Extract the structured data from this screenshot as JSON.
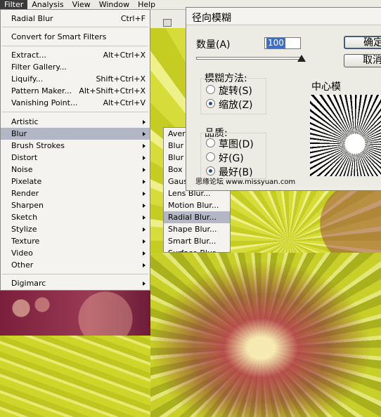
{
  "menubar": {
    "items": [
      "Filter",
      "Analysis",
      "View",
      "Window",
      "Help"
    ]
  },
  "filter_menu": {
    "items": [
      {
        "label": "Radial Blur",
        "shortcut": "Ctrl+F"
      },
      {
        "label": "Convert for Smart Filters",
        "shortcut": ""
      },
      {
        "label": "Extract...",
        "shortcut": "Alt+Ctrl+X"
      },
      {
        "label": "Filter Gallery...",
        "shortcut": ""
      },
      {
        "label": "Liquify...",
        "shortcut": "Shift+Ctrl+X"
      },
      {
        "label": "Pattern Maker...",
        "shortcut": "Alt+Shift+Ctrl+X"
      },
      {
        "label": "Vanishing Point...",
        "shortcut": "Alt+Ctrl+V"
      },
      {
        "label": "Artistic",
        "shortcut": ""
      },
      {
        "label": "Blur",
        "shortcut": ""
      },
      {
        "label": "Brush Strokes",
        "shortcut": ""
      },
      {
        "label": "Distort",
        "shortcut": ""
      },
      {
        "label": "Noise",
        "shortcut": ""
      },
      {
        "label": "Pixelate",
        "shortcut": ""
      },
      {
        "label": "Render",
        "shortcut": ""
      },
      {
        "label": "Sharpen",
        "shortcut": ""
      },
      {
        "label": "Sketch",
        "shortcut": ""
      },
      {
        "label": "Stylize",
        "shortcut": ""
      },
      {
        "label": "Texture",
        "shortcut": ""
      },
      {
        "label": "Video",
        "shortcut": ""
      },
      {
        "label": "Other",
        "shortcut": ""
      },
      {
        "label": "Digimarc",
        "shortcut": ""
      }
    ]
  },
  "blur_submenu": {
    "items": [
      "Aver",
      "Blur",
      "Blur M",
      "Box B",
      "Gaus",
      "Lens Blur...",
      "Motion Blur...",
      "Radial Blur...",
      "Shape Blur...",
      "Smart Blur...",
      "Surface Blur..."
    ]
  },
  "dialog": {
    "title": "径向模糊",
    "amount_label": "数量(A)",
    "amount_value": "100",
    "blur_method_label": "模糊方法:",
    "spin_label": "旋转(S)",
    "zoom_label": "缩放(Z)",
    "quality_label": "品质:",
    "draft_label": "草图(D)",
    "good_label": "好(G)",
    "best_label": "最好(B)",
    "ok_label": "确定",
    "cancel_label": "取消",
    "center_label": "中心模"
  },
  "watermark": "思缘论坛  www.missyuan.com"
}
